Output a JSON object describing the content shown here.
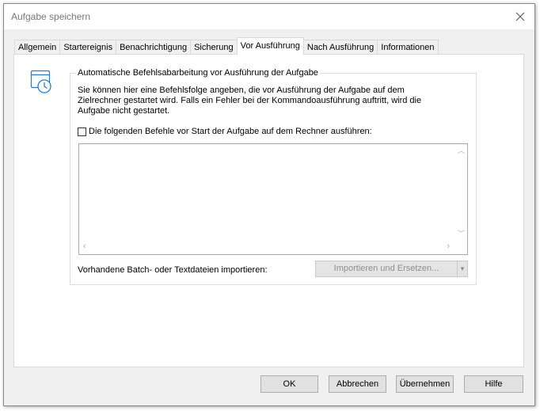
{
  "window": {
    "title": "Aufgabe speichern"
  },
  "tabs": [
    {
      "label": "Allgemein",
      "active": false
    },
    {
      "label": "Startereignis",
      "active": false
    },
    {
      "label": "Benachrichtigung",
      "active": false
    },
    {
      "label": "Sicherung",
      "active": false
    },
    {
      "label": "Vor Ausführung",
      "active": true
    },
    {
      "label": "Nach Ausführung",
      "active": false
    },
    {
      "label": "Informationen",
      "active": false
    }
  ],
  "group": {
    "legend": "Automatische Befehlsabarbeitung vor Ausführung der Aufgabe",
    "description": "Sie können hier eine Befehlsfolge angeben, die vor Ausführung der Aufgabe auf dem Zielrechner gestartet wird. Falls ein Fehler bei der Kommandoausführung auftritt, wird die Aufgabe nicht gestartet.",
    "checkbox_label": "Die folgenden Befehle vor Start der Aufgabe auf dem Rechner ausführen:",
    "checkbox_checked": false,
    "commands_value": "",
    "import_label": "Vorhandene Batch- oder Textdateien importieren:",
    "import_button": "Importieren und Ersetzen..."
  },
  "buttons": {
    "ok": "OK",
    "cancel": "Abbrechen",
    "apply": "Übernehmen",
    "help": "Hilfe"
  },
  "icons": {
    "close": "close-icon",
    "panel": "calendar-clock-icon"
  },
  "colors": {
    "icon_accent": "#1e7fd6",
    "disabled_text": "#8f8f8f"
  }
}
